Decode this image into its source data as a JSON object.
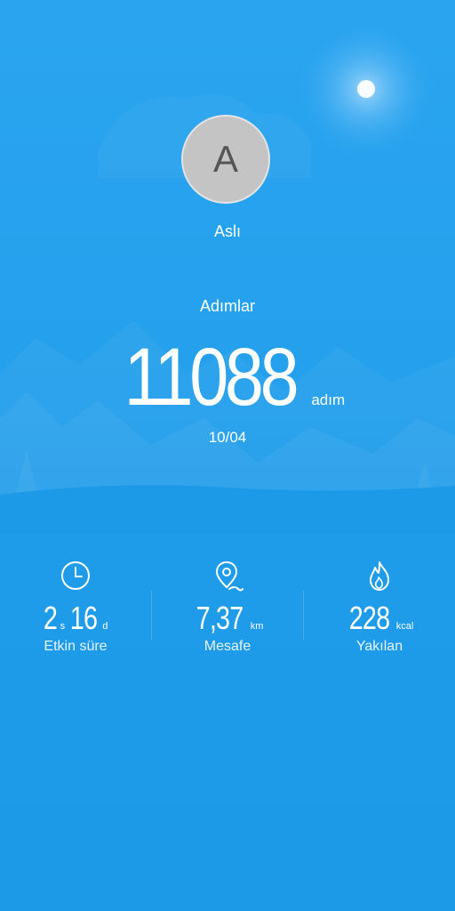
{
  "profile": {
    "avatar_initial": "A",
    "name": "Aslı"
  },
  "steps": {
    "label": "Adımlar",
    "value": "11088",
    "unit": "adım",
    "date": "10/04"
  },
  "stats": {
    "active_time": {
      "icon": "clock-icon",
      "hours": "2",
      "hours_unit": "s",
      "minutes": "16",
      "minutes_unit": "d",
      "label": "Etkin süre"
    },
    "distance": {
      "icon": "location-pin-icon",
      "value": "7,37",
      "unit": "km",
      "label": "Mesafe"
    },
    "calories": {
      "icon": "flame-icon",
      "value": "228",
      "unit": "kcal",
      "label": "Yakılan"
    }
  },
  "colors": {
    "background": "#1e9cea",
    "text": "#ffffff",
    "avatar": "#c4c4c4"
  }
}
